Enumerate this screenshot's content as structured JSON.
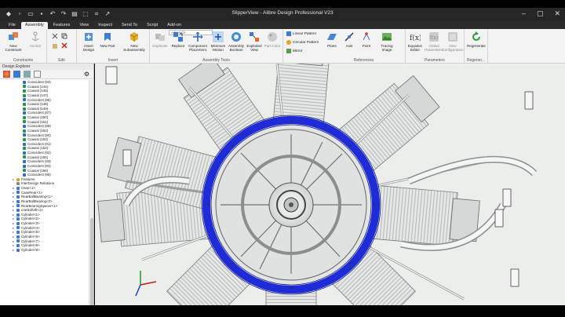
{
  "window": {
    "title": "SlipperView - Alibre Design Professional V23",
    "controls": [
      "–",
      "▢",
      "✕"
    ]
  },
  "tabs": [
    "File",
    "Assembly",
    "Features",
    "View",
    "Inspect",
    "Send To",
    "Script",
    "Add-on"
  ],
  "active_tab": "Assembly",
  "search": {
    "label": "Search"
  },
  "ribbon": {
    "constraints": {
      "label": "Constraints",
      "new_constraint": "New Constraint",
      "anchor": "Anchor"
    },
    "edit": {
      "label": "Edit"
    },
    "insert": {
      "label": "Insert",
      "insert_design": "Insert Design",
      "new_part": "New Part",
      "new_subassembly": "New Subassembly"
    },
    "assembly_tools": {
      "label": "Assembly Tools",
      "duplicate": "Duplicate",
      "replace": "Replace",
      "component_placement": "Component Placement",
      "minimum_motion": "Minimum Motion",
      "assembly_boolean": "Assembly Boolean",
      "exploded_view": "Exploded View",
      "part_color": "Part Color"
    },
    "patterns": {
      "linear_pattern": "Linear Pattern",
      "circular_pattern": "Circular Pattern",
      "mirror": "Mirror"
    },
    "references": {
      "label": "References",
      "plane": "Plane",
      "axis": "Axis",
      "point": "Point",
      "tracing_image": "Tracing Image"
    },
    "parameters": {
      "label": "Parameters",
      "equation_editor": "Equation Editor",
      "global_parameters": "Global Parameters",
      "new_configuration": "New Configuration"
    },
    "regenerate": {
      "label": "Regener...",
      "regenerate": "Regenerate"
    }
  },
  "design_explorer": {
    "title": "Design Explorer",
    "items": [
      {
        "label": "Coincident (84)",
        "kind": "coincident",
        "indent": 3
      },
      {
        "label": "Coaxial (144)",
        "kind": "coaxial",
        "indent": 3
      },
      {
        "label": "Coaxial (145)",
        "kind": "coaxial",
        "indent": 3
      },
      {
        "label": "Coaxial (147)",
        "kind": "coaxial",
        "indent": 3
      },
      {
        "label": "Coincident (85)",
        "kind": "coincident",
        "indent": 3
      },
      {
        "label": "Coaxial (148)",
        "kind": "coaxial",
        "indent": 3
      },
      {
        "label": "Coaxial (149)",
        "kind": "coaxial",
        "indent": 3
      },
      {
        "label": "Coincident (87)",
        "kind": "coincident",
        "indent": 3
      },
      {
        "label": "Coaxial (150)",
        "kind": "coaxial",
        "indent": 3
      },
      {
        "label": "Coaxial (151)",
        "kind": "coaxial",
        "indent": 3
      },
      {
        "label": "Coincident (89)",
        "kind": "coincident",
        "indent": 3
      },
      {
        "label": "Coaxial (152)",
        "kind": "coaxial",
        "indent": 3
      },
      {
        "label": "Coincident (90)",
        "kind": "coincident",
        "indent": 3
      },
      {
        "label": "Coaxial (153)",
        "kind": "coaxial",
        "indent": 3
      },
      {
        "label": "Coincident (91)",
        "kind": "coincident",
        "indent": 3
      },
      {
        "label": "Coaxial (154)",
        "kind": "coaxial",
        "indent": 3
      },
      {
        "label": "Coincident (92)",
        "kind": "coincident",
        "indent": 3
      },
      {
        "label": "Coaxial (155)",
        "kind": "coaxial",
        "indent": 3
      },
      {
        "label": "Coincident (93)",
        "kind": "coincident",
        "indent": 3
      },
      {
        "label": "Coincident (94)",
        "kind": "coincident",
        "indent": 3
      },
      {
        "label": "Coaxial (156)",
        "kind": "coaxial",
        "indent": 3
      },
      {
        "label": "Coincident (95)",
        "kind": "coincident",
        "indent": 3
      },
      {
        "label": "Features",
        "kind": "folder",
        "indent": 2
      },
      {
        "label": "InterDesign Relations",
        "kind": "relations",
        "indent": 2
      },
      {
        "label": "Case<1>",
        "kind": "part",
        "indent": 2
      },
      {
        "label": "CaseRear<1>",
        "kind": "part",
        "indent": 2
      },
      {
        "label": "RearBallBearing<1>",
        "kind": "part",
        "indent": 2
      },
      {
        "label": "RearBallBearing<2>",
        "kind": "part",
        "indent": 2
      },
      {
        "label": "RearBearingSpacer<1>",
        "kind": "part",
        "indent": 2
      },
      {
        "label": "crankshaft<1>",
        "kind": "part",
        "indent": 2
      },
      {
        "label": "Cylinder<1>",
        "kind": "part",
        "indent": 2
      },
      {
        "label": "Cylinder<2>",
        "kind": "part",
        "indent": 2
      },
      {
        "label": "Cylinder<3>",
        "kind": "part",
        "indent": 2
      },
      {
        "label": "Cylinder<4>",
        "kind": "part",
        "indent": 2
      },
      {
        "label": "Cylinder<5>",
        "kind": "part",
        "indent": 2
      },
      {
        "label": "Cylinder<6>",
        "kind": "part",
        "indent": 2
      },
      {
        "label": "Cylinder<7>",
        "kind": "part",
        "indent": 2
      },
      {
        "label": "Cylinder<8>",
        "kind": "part",
        "indent": 2
      },
      {
        "label": "Cylinder<9>",
        "kind": "part",
        "indent": 2
      }
    ]
  },
  "colors": {
    "coincident": "#2f6fbf",
    "coaxial": "#1f9a4a",
    "part": "#3c78d8",
    "folder": "#d9a425",
    "selection_ring": "#1e2bd6"
  }
}
